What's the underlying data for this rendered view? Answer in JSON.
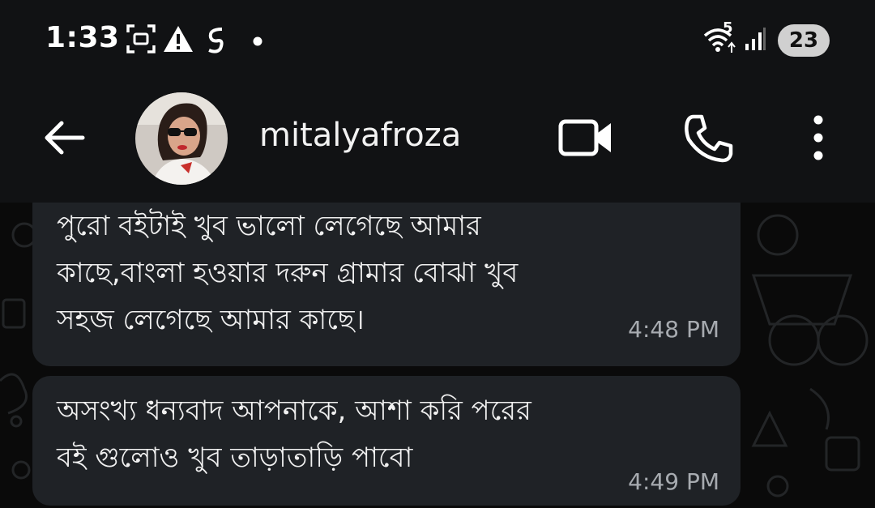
{
  "status_bar": {
    "time": "1:33",
    "network_badge": "5",
    "battery_level": "23",
    "icons": [
      "screenshot-icon",
      "alert-icon",
      "data-saver-icon",
      "dot-icon",
      "wifi-icon",
      "signal-icon",
      "battery-icon"
    ]
  },
  "header": {
    "contact_name": "mitalyafroza",
    "icons": [
      "back-arrow-icon",
      "avatar",
      "video-call-icon",
      "phone-icon",
      "more-icon"
    ]
  },
  "messages": [
    {
      "lines": [
        "পুরো বইটাই খুব  ভালো লেগেছে আমার",
        "কাছে,বাংলা হওয়ার দরুন গ্রামার বোঝা খুব",
        "সহজ লেগেছে আমার কাছে।"
      ],
      "time": "4:48 PM"
    },
    {
      "lines": [
        "অসংখ্য ধন্যবাদ আপনাকে, আশা করি পরের",
        "বই গুলোও খুব তাড়াতাড়ি পাবো"
      ],
      "time": "4:49 PM"
    }
  ],
  "colors": {
    "header_bg": "#111214",
    "chat_bg": "#0a0a0a",
    "bubble_bg": "#1f2226",
    "timestamp": "#a7abb0"
  }
}
